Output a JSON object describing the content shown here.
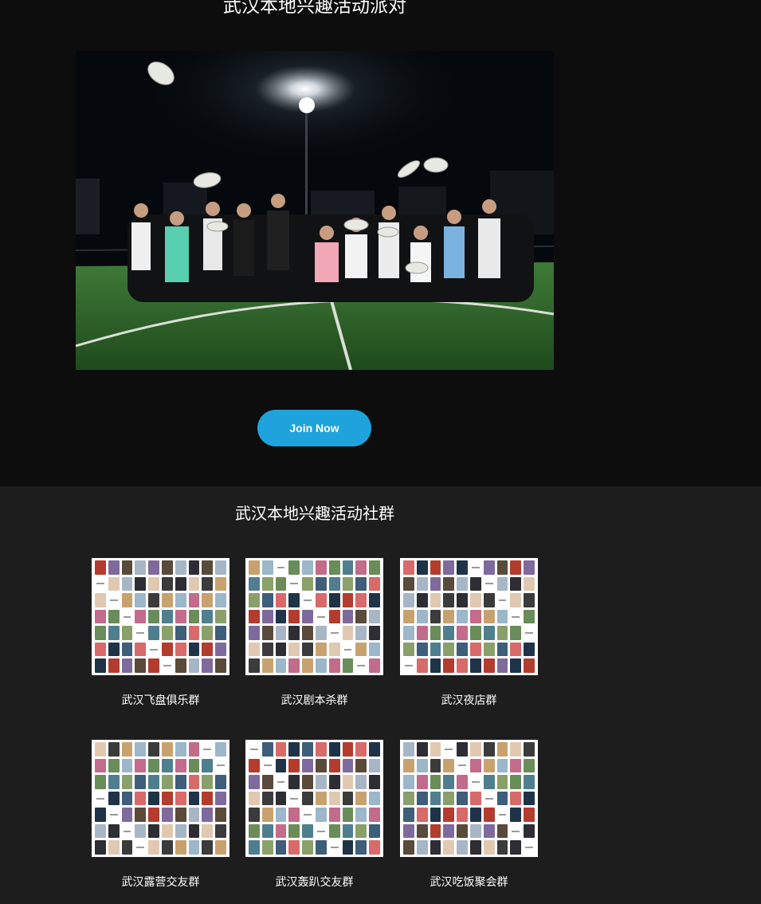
{
  "hero": {
    "title": "武汉本地兴趣活动派对",
    "photo_alt": "group photo of frisbee players at night on a football field",
    "join_label": "Join Now"
  },
  "groups": {
    "title": "武汉本地兴趣活动社群",
    "items": [
      {
        "label": "武汉飞盘俱乐群"
      },
      {
        "label": "武汉剧本杀群"
      },
      {
        "label": "武汉夜店群"
      },
      {
        "label": "武汉露营交友群"
      },
      {
        "label": "武汉轰趴交友群"
      },
      {
        "label": "武汉吃饭聚会群"
      }
    ]
  },
  "colors": {
    "page_background": "#0d0d0d",
    "section_background": "#1d1d1d",
    "button": "#1fa3dc",
    "text": "#ffffff"
  }
}
